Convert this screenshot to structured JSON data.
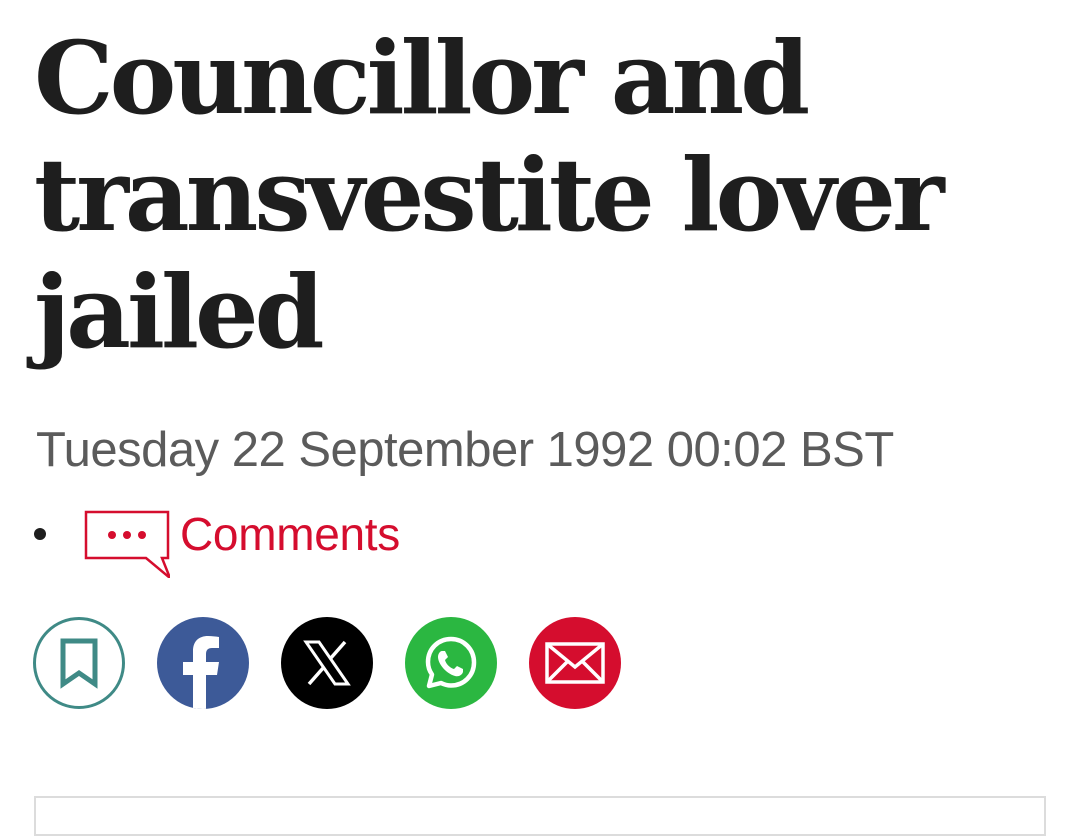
{
  "article": {
    "headline": "Councillor and transvestite lover jailed",
    "dateline": "Tuesday 22 September 1992 00:02 BST",
    "comments_label": "Comments"
  },
  "share": {
    "buttons": [
      {
        "name": "bookmark",
        "icon": "bookmark-icon",
        "color": "#3f8a86"
      },
      {
        "name": "facebook",
        "icon": "facebook-icon",
        "color": "#3d5a98"
      },
      {
        "name": "x",
        "icon": "x-icon",
        "color": "#000000"
      },
      {
        "name": "whatsapp",
        "icon": "whatsapp-icon",
        "color": "#2bb741"
      },
      {
        "name": "email",
        "icon": "email-icon",
        "color": "#d50d2e"
      }
    ]
  },
  "colors": {
    "headline": "#1e1e1e",
    "dateline": "#5b5b5b",
    "accent": "#d50d2e"
  }
}
